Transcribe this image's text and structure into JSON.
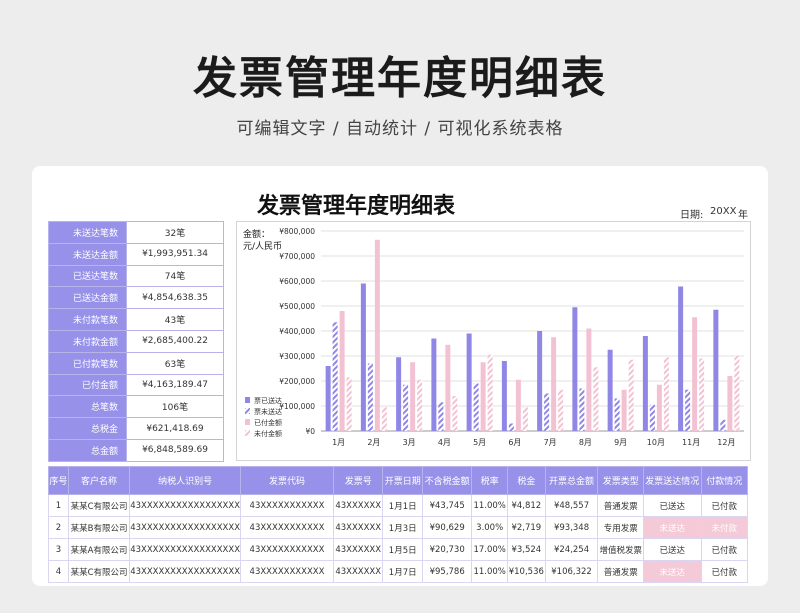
{
  "hero": {
    "title": "发票管理年度明细表",
    "subtitle": "可编辑文字  /  自动统计  /  可视化系统表格"
  },
  "sheet": {
    "title": "发票管理年度明细表",
    "date_label": "日期:",
    "date_value": "20XX",
    "date_unit": "年"
  },
  "summary": [
    {
      "label": "未送达笔数",
      "value": "32笔"
    },
    {
      "label": "未送达金额",
      "value": "¥1,993,951.34"
    },
    {
      "label": "已送达笔数",
      "value": "74笔"
    },
    {
      "label": "已送达金额",
      "value": "¥4,854,638.35"
    },
    {
      "label": "未付款笔数",
      "value": "43笔"
    },
    {
      "label": "未付款金额",
      "value": "¥2,685,400.22"
    },
    {
      "label": "已付款笔数",
      "value": "63笔"
    },
    {
      "label": "已付金额",
      "value": "¥4,163,189.47"
    },
    {
      "label": "总笔数",
      "value": "106笔"
    },
    {
      "label": "总税金",
      "value": "¥621,418.69"
    },
    {
      "label": "总金额",
      "value": "¥6,848,589.69"
    }
  ],
  "chart_data": {
    "type": "bar",
    "ylabel": "金额：元/人民币",
    "ylabel_line1": "金额：",
    "ylabel_line2": "元/人民币",
    "ylim": [
      0,
      800000
    ],
    "yticks": [
      0,
      100000,
      200000,
      300000,
      400000,
      500000,
      600000,
      700000,
      800000
    ],
    "ytick_labels": [
      "¥0",
      "¥100,000",
      "¥200,000",
      "¥300,000",
      "¥400,000",
      "¥500,000",
      "¥600,000",
      "¥700,000",
      "¥800,000"
    ],
    "categories": [
      "1月",
      "2月",
      "3月",
      "4月",
      "5月",
      "6月",
      "7月",
      "8月",
      "9月",
      "10月",
      "11月",
      "12月"
    ],
    "legend_position": "bottom-left",
    "series": [
      {
        "name": "票已送达",
        "color": "#8f86e6",
        "pattern": "solid",
        "values": [
          260000,
          590000,
          295000,
          370000,
          390000,
          280000,
          400000,
          495000,
          325000,
          380000,
          578000,
          485000
        ]
      },
      {
        "name": "票未送达",
        "color": "#8f86e6",
        "pattern": "hatch",
        "values": [
          435000,
          270000,
          185000,
          115000,
          190000,
          30000,
          150000,
          170000,
          130000,
          105000,
          165000,
          45000
        ]
      },
      {
        "name": "已付金额",
        "color": "#f2c2d3",
        "pattern": "solid",
        "values": [
          480000,
          765000,
          275000,
          345000,
          275000,
          205000,
          375000,
          410000,
          165000,
          185000,
          455000,
          220000
        ]
      },
      {
        "name": "未付金额",
        "color": "#f2c2d3",
        "pattern": "hatch",
        "values": [
          215000,
          95000,
          205000,
          140000,
          305000,
          95000,
          165000,
          255000,
          285000,
          295000,
          290000,
          300000
        ]
      }
    ]
  },
  "ledger": {
    "headers": [
      "序号",
      "客户名称",
      "纳税人识别号",
      "发票代码",
      "发票号",
      "开票日期",
      "不含税金额",
      "税率",
      "税金",
      "开票总金额",
      "发票类型",
      "发票送达情况",
      "付款情况"
    ],
    "rows": [
      [
        "1",
        "某某C有限公司",
        "43XXXXXXXXXXXXXXXXX",
        "43XXXXXXXXXXX",
        "43XXXXXX",
        "1月1日",
        "¥43,745",
        "11.00%",
        "¥4,812",
        "¥48,557",
        "普通发票",
        "已送达",
        "已付款"
      ],
      [
        "2",
        "某某B有限公司",
        "43XXXXXXXXXXXXXXXXX",
        "43XXXXXXXXXXX",
        "43XXXXXX",
        "1月3日",
        "¥90,629",
        "3.00%",
        "¥2,719",
        "¥93,348",
        "专用发票",
        "未送达",
        "未付款"
      ],
      [
        "3",
        "某某A有限公司",
        "43XXXXXXXXXXXXXXXXX",
        "43XXXXXXXXXXX",
        "43XXXXXX",
        "1月5日",
        "¥20,730",
        "17.00%",
        "¥3,524",
        "¥24,254",
        "增值税发票",
        "已送达",
        "已付款"
      ],
      [
        "4",
        "某某C有限公司",
        "43XXXXXXXXXXXXXXXXX",
        "43XXXXXXXXXXX",
        "43XXXXXX",
        "1月7日",
        "¥95,786",
        "11.00%",
        "¥10,536",
        "¥106,322",
        "普通发票",
        "未送达",
        "已付款"
      ]
    ],
    "highlight_value": [
      "未送达",
      "未付款"
    ],
    "highlight_color": "#f4c9d8"
  }
}
